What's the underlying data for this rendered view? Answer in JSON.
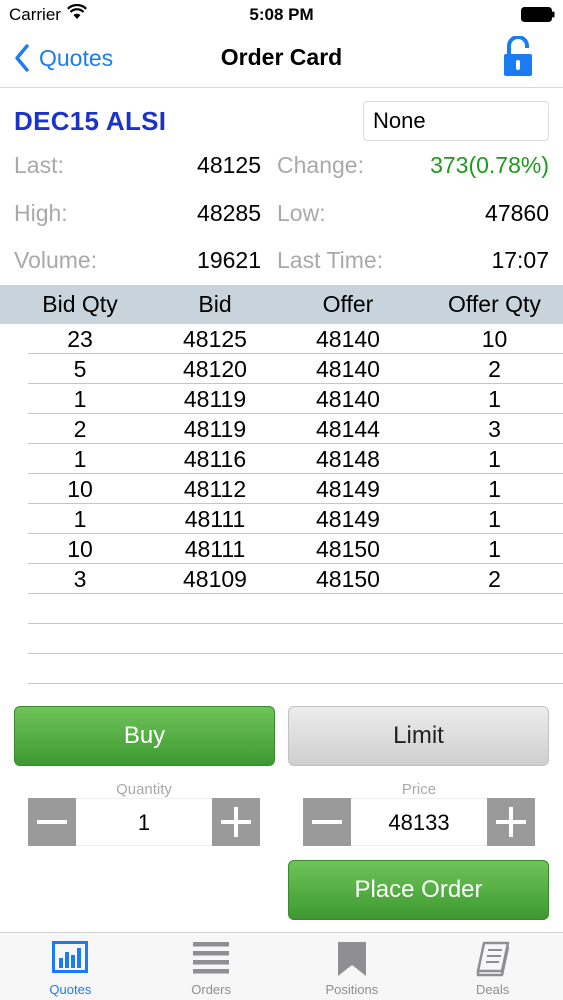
{
  "status_bar": {
    "carrier": "Carrier",
    "time": "5:08 PM"
  },
  "nav": {
    "back_label": "Quotes",
    "title": "Order Card"
  },
  "instrument": {
    "name": "DEC15 ALSI",
    "filter_value": "None"
  },
  "stats": {
    "last_label": "Last:",
    "last_value": "48125",
    "change_label": "Change:",
    "change_value": "373(0.78%)",
    "high_label": "High:",
    "high_value": "48285",
    "low_label": "Low:",
    "low_value": "47860",
    "volume_label": "Volume:",
    "volume_value": "19621",
    "last_time_label": "Last Time:",
    "last_time_value": "17:07"
  },
  "depth": {
    "headers": [
      "Bid Qty",
      "Bid",
      "Offer",
      "Offer Qty"
    ],
    "rows": [
      [
        "23",
        "48125",
        "48140",
        "10"
      ],
      [
        "5",
        "48120",
        "48140",
        "2"
      ],
      [
        "1",
        "48119",
        "48140",
        "1"
      ],
      [
        "2",
        "48119",
        "48144",
        "3"
      ],
      [
        "1",
        "48116",
        "48148",
        "1"
      ],
      [
        "10",
        "48112",
        "48149",
        "1"
      ],
      [
        "1",
        "48111",
        "48149",
        "1"
      ],
      [
        "10",
        "48111",
        "48150",
        "1"
      ],
      [
        "3",
        "48109",
        "48150",
        "2"
      ],
      [
        "",
        "",
        "",
        ""
      ],
      [
        "",
        "",
        "",
        ""
      ],
      [
        "",
        "",
        "",
        ""
      ]
    ]
  },
  "order": {
    "side_label": "Buy",
    "type_label": "Limit",
    "quantity_label": "Quantity",
    "quantity_value": "1",
    "price_label": "Price",
    "price_value": "48133",
    "place_label": "Place Order"
  },
  "tabs": [
    {
      "label": "Quotes",
      "icon": "chart-icon",
      "active": true
    },
    {
      "label": "Orders",
      "icon": "list-icon",
      "active": false
    },
    {
      "label": "Positions",
      "icon": "bookmark-icon",
      "active": false
    },
    {
      "label": "Deals",
      "icon": "book-icon",
      "active": false
    }
  ],
  "colors": {
    "accent": "#1a7bf2",
    "instrument": "#1c33c8",
    "positive": "#1d9a1d",
    "buy": "#4caf3f",
    "table_header": "#c9d3db"
  }
}
